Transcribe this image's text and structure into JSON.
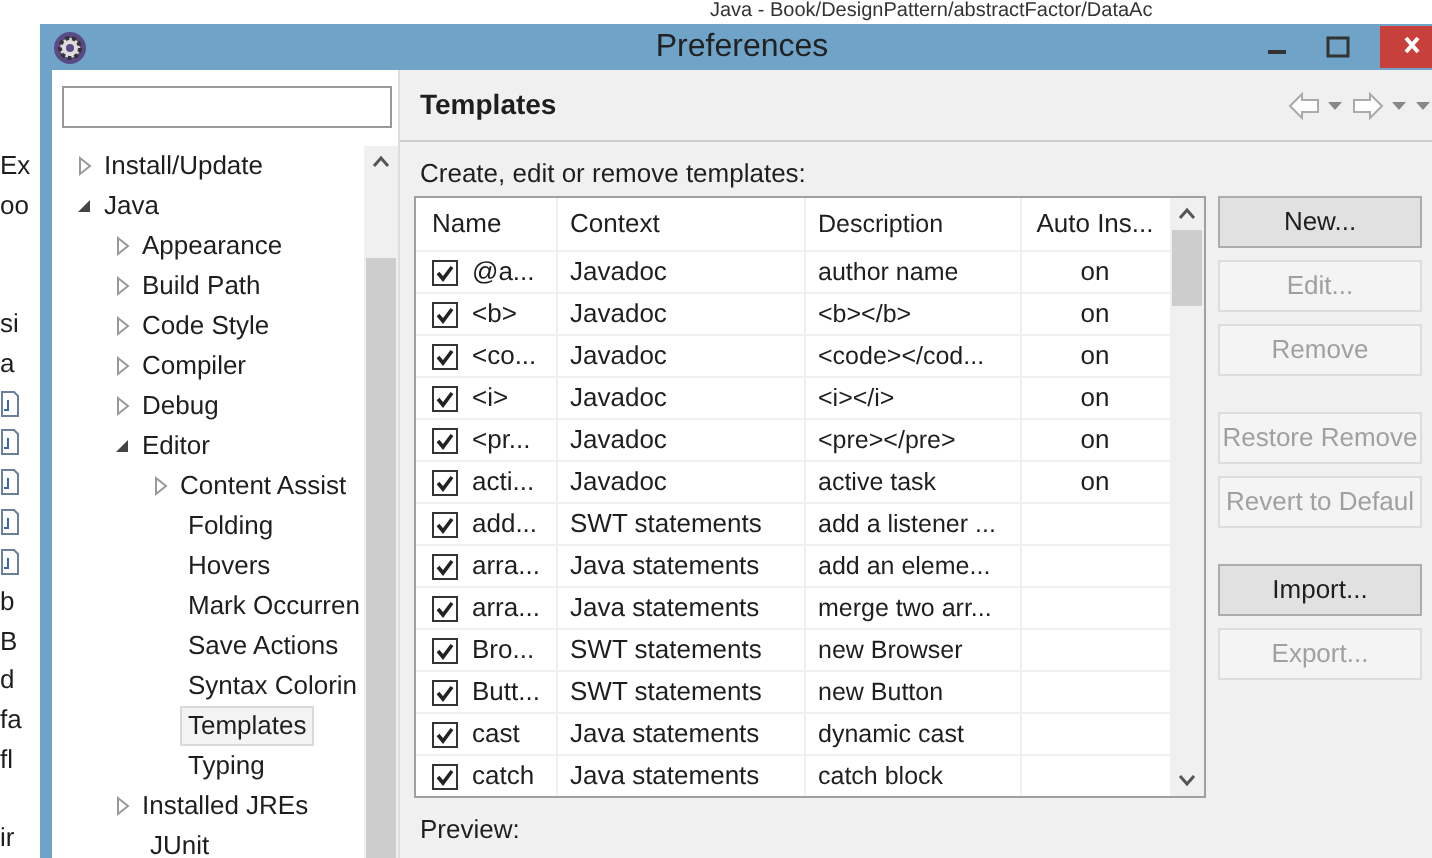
{
  "background_window": {
    "title": "Java - Book/DesignPattern/abstractFactor/DataAc",
    "edge_rows": [
      {
        "kind": "text",
        "text": "Ex"
      },
      {
        "kind": "text",
        "text": "oo"
      },
      {
        "kind": "blank"
      },
      {
        "kind": "blank"
      },
      {
        "kind": "text",
        "text": "si"
      },
      {
        "kind": "text",
        "text": "a"
      },
      {
        "kind": "file"
      },
      {
        "kind": "file"
      },
      {
        "kind": "file"
      },
      {
        "kind": "file"
      },
      {
        "kind": "file"
      },
      {
        "kind": "text",
        "text": "b"
      },
      {
        "kind": "text",
        "text": "B"
      },
      {
        "kind": "text",
        "text": "d"
      },
      {
        "kind": "text",
        "text": "fa"
      },
      {
        "kind": "text",
        "text": "fl"
      },
      {
        "kind": "blank"
      },
      {
        "kind": "text",
        "text": "ir"
      }
    ]
  },
  "window": {
    "title": "Preferences"
  },
  "tree": [
    {
      "label": "Install/Update",
      "expanded": false,
      "selected": false
    },
    {
      "label": "Java",
      "expanded": true,
      "selected": false,
      "children": [
        {
          "label": "Appearance",
          "expanded": false,
          "selected": false
        },
        {
          "label": "Build Path",
          "expanded": false,
          "selected": false
        },
        {
          "label": "Code Style",
          "expanded": false,
          "selected": false
        },
        {
          "label": "Compiler",
          "expanded": false,
          "selected": false
        },
        {
          "label": "Debug",
          "expanded": false,
          "selected": false
        },
        {
          "label": "Editor",
          "expanded": true,
          "selected": false,
          "children": [
            {
              "label": "Content Assist",
              "expanded": false,
              "selected": false
            },
            {
              "label": "Folding",
              "selected": false
            },
            {
              "label": "Hovers",
              "selected": false
            },
            {
              "label": "Mark Occurren",
              "selected": false
            },
            {
              "label": "Save Actions",
              "selected": false
            },
            {
              "label": "Syntax Colorin",
              "selected": false
            },
            {
              "label": "Templates",
              "selected": true
            },
            {
              "label": "Typing",
              "selected": false
            }
          ]
        },
        {
          "label": "Installed JREs",
          "expanded": false,
          "selected": false
        },
        {
          "label": "JUnit",
          "selected": false
        }
      ]
    }
  ],
  "page": {
    "title": "Templates",
    "intro": "Create, edit or remove templates:",
    "preview_label": "Preview:"
  },
  "table": {
    "columns": [
      "Name",
      "Context",
      "Description",
      "Auto Ins..."
    ],
    "rows": [
      {
        "checked": true,
        "name": "@a...",
        "context": "Javadoc",
        "description": "author name",
        "auto": "on"
      },
      {
        "checked": true,
        "name": "<b>",
        "context": "Javadoc",
        "description": "<b></b>",
        "auto": "on"
      },
      {
        "checked": true,
        "name": "<co...",
        "context": "Javadoc",
        "description": "<code></cod...",
        "auto": "on"
      },
      {
        "checked": true,
        "name": "<i>",
        "context": "Javadoc",
        "description": "<i></i>",
        "auto": "on"
      },
      {
        "checked": true,
        "name": "<pr...",
        "context": "Javadoc",
        "description": "<pre></pre>",
        "auto": "on"
      },
      {
        "checked": true,
        "name": "acti...",
        "context": "Javadoc",
        "description": "active task",
        "auto": "on"
      },
      {
        "checked": true,
        "name": "add...",
        "context": "SWT statements",
        "description": "add a listener ..."
      },
      {
        "checked": true,
        "name": "arra...",
        "context": "Java statements",
        "description": "add an eleme..."
      },
      {
        "checked": true,
        "name": "arra...",
        "context": "Java statements",
        "description": "merge two arr..."
      },
      {
        "checked": true,
        "name": "Bro...",
        "context": "SWT statements",
        "description": "new Browser"
      },
      {
        "checked": true,
        "name": "Butt...",
        "context": "SWT statements",
        "description": "new Button"
      },
      {
        "checked": true,
        "name": "cast",
        "context": "Java statements",
        "description": "dynamic cast"
      },
      {
        "checked": true,
        "name": "catch",
        "context": "Java statements",
        "description": "catch block"
      }
    ]
  },
  "button_groups": [
    [
      {
        "label": "New...",
        "disabled": false
      },
      {
        "label": "Edit...",
        "disabled": true
      },
      {
        "label": "Remove",
        "disabled": true
      }
    ],
    [
      {
        "label": "Restore Remove",
        "disabled": true
      },
      {
        "label": "Revert to Defaul",
        "disabled": true
      }
    ],
    [
      {
        "label": "Import...",
        "disabled": false
      },
      {
        "label": "Export...",
        "disabled": true
      }
    ]
  ]
}
